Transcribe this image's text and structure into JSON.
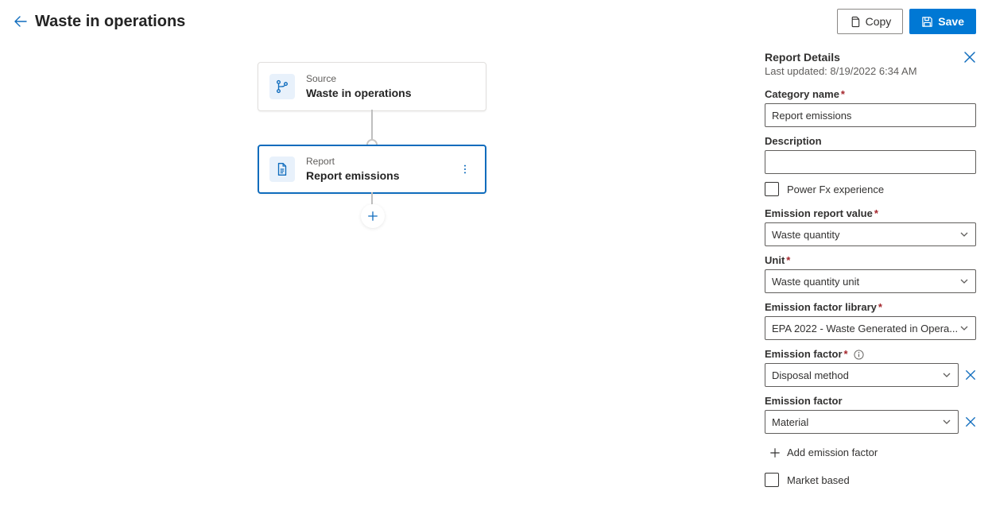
{
  "header": {
    "title": "Waste in operations",
    "copy_label": "Copy",
    "save_label": "Save"
  },
  "canvas": {
    "source": {
      "type_label": "Source",
      "name": "Waste in operations"
    },
    "report": {
      "type_label": "Report",
      "name": "Report emissions"
    }
  },
  "panel": {
    "title": "Report Details",
    "last_updated": "Last updated: 8/19/2022 6:34 AM",
    "category_name_label": "Category name",
    "category_name_value": "Report emissions",
    "description_label": "Description",
    "description_value": "",
    "powerfx_label": "Power Fx experience",
    "emission_report_value_label": "Emission report value",
    "emission_report_value_value": "Waste quantity",
    "unit_label": "Unit",
    "unit_value": "Waste quantity unit",
    "efl_label": "Emission factor library",
    "efl_value": "EPA 2022 - Waste Generated in Opera...",
    "ef_label": "Emission factor",
    "ef_value_1": "Disposal method",
    "ef2_label": "Emission factor",
    "ef_value_2": "Material",
    "add_factor_label": "Add emission factor",
    "market_based_label": "Market based"
  }
}
